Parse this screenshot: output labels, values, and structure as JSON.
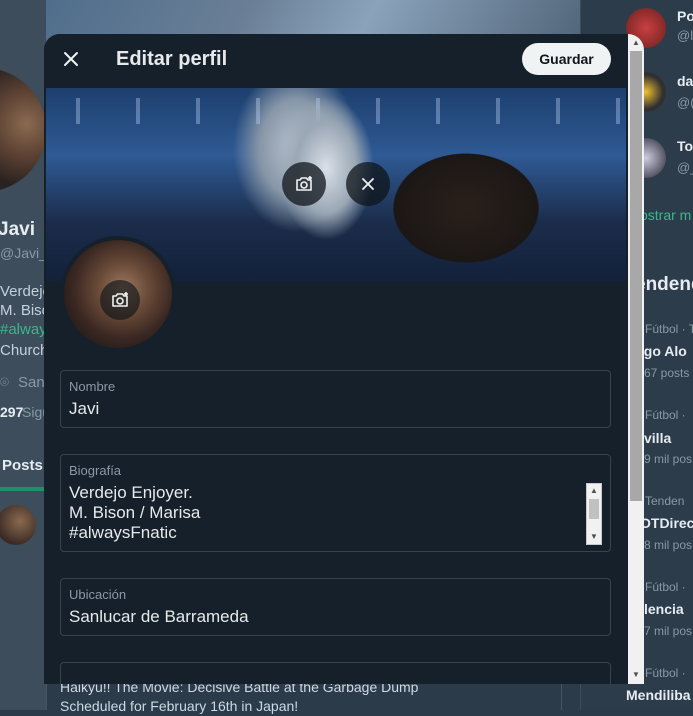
{
  "background": {
    "profile": {
      "name": "Javi",
      "handle": "@Javi_F",
      "bio_lines": [
        "Verdejo",
        "M. Bison",
        "#alway",
        "Church"
      ],
      "location": "San",
      "following_count": "297",
      "following_label": "Sigu"
    },
    "tab_posts": "Posts",
    "tweet_preview_line1": "Haikyu!! The Movie: Decisive Battle at the Garbage Dump",
    "tweet_preview_line2": "Scheduled for February 16th in Japan!",
    "who_to_follow": [
      {
        "name": "Po",
        "handle": "@l"
      },
      {
        "name": "da",
        "handle": "@("
      },
      {
        "name": "To",
        "handle": "@_"
      }
    ],
    "show_more": "ostrar m",
    "trends_title": "endend",
    "trends": [
      {
        "context": "Fútbol · T",
        "name": "ego Alo",
        "count": "67 posts"
      },
      {
        "context": "Fútbol ·",
        "name": "villa",
        "count": "9 mil pos"
      },
      {
        "context": "Tenden",
        "name": "OTDirec",
        "count": "8 mil pos"
      },
      {
        "context": "Fútbol ·",
        "name": "lencia",
        "count": "7 mil pos"
      },
      {
        "context": "Fútbol ·",
        "name": "Mendiliba",
        "count": ""
      }
    ]
  },
  "modal": {
    "title": "Editar perfil",
    "save_label": "Guardar",
    "fields": {
      "name": {
        "label": "Nombre",
        "value": "Javi"
      },
      "bio": {
        "label": "Biografía",
        "value": "Verdejo Enjoyer.\nM. Bison / Marisa\n#alwaysFnatic"
      },
      "location": {
        "label": "Ubicación",
        "value": "Sanlucar de Barrameda"
      }
    }
  },
  "colors": {
    "modal_bg": "#15202b",
    "border": "#38444d",
    "label": "#8b98a5",
    "save_bg": "#eff3f4",
    "accent_green": "#1e8f6c"
  }
}
